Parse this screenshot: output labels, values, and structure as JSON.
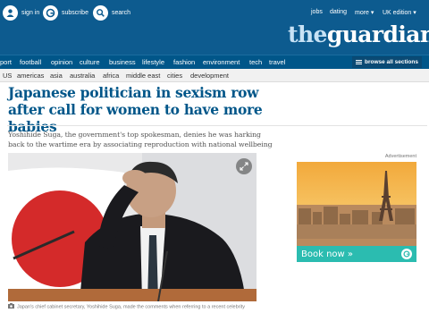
{
  "topbar": {
    "signin_label": "sign in",
    "subscribe_label": "subscribe",
    "search_label": "search",
    "jobs": "jobs",
    "dating": "dating",
    "more": "more ▾",
    "edition": "UK edition ▾"
  },
  "logo": {
    "part1": "the",
    "part2": "guardian"
  },
  "nav": {
    "items": [
      "port",
      "football",
      "opinion",
      "culture",
      "business",
      "lifestyle",
      "fashion",
      "environment",
      "tech",
      "travel"
    ],
    "browse_label": "browse all sections"
  },
  "subnav": {
    "items": [
      "US",
      "americas",
      "asia",
      "australia",
      "africa",
      "middle east",
      "cities",
      "development"
    ]
  },
  "article": {
    "headline": "Japanese politician in sexism row after call for women to have more babies",
    "standfirst": "Yoshihide Suga, the government's top spokesman, denies he was harking back to the wartime era by associating reproduction with national wellbeing",
    "caption": "Japan's chief cabinet secretary, Yoshihide Suga, made the comments when referring to a recent celebrity"
  },
  "ad": {
    "label": "Advertisement",
    "cta": "Book now »"
  },
  "colors": {
    "masthead": "#0d5b8f",
    "nav": "#005689",
    "headline": "#005689",
    "ad_cta": "#2bbcb0"
  },
  "icons": [
    "user-icon",
    "guardian-g-icon",
    "search-icon",
    "expand-icon",
    "camera-icon",
    "menu-icon"
  ]
}
